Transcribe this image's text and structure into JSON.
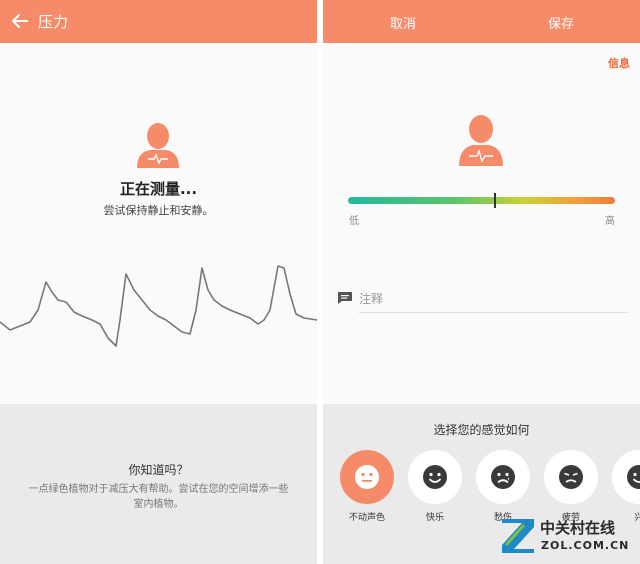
{
  "left_screen": {
    "appbar": {
      "title": "压力",
      "back_icon": "arrow-left-icon",
      "color": "#f58b69"
    },
    "avatar_icon": "person-heartbeat-icon",
    "measuring_title": "正在测量...",
    "measuring_subtitle": "尝试保持静止和安静。",
    "tip": {
      "title": "你知道吗？",
      "body": "一点绿色植物对于减压大有帮助。尝试在您的空间增添一些室内植物。"
    }
  },
  "right_screen": {
    "appbar": {
      "cancel_label": "取消",
      "save_label": "保存"
    },
    "info_label": "信息",
    "avatar_icon": "person-heartbeat-icon",
    "scale": {
      "low_label": "低",
      "high_label": "高",
      "level": 0.55
    },
    "note": {
      "icon": "comment-icon",
      "placeholder": "注释"
    },
    "mood_title": "选择您的感觉如何",
    "moods": [
      {
        "label": "不动声色",
        "icon": "neutral-face-icon",
        "selected": true
      },
      {
        "label": "快乐",
        "icon": "happy-face-icon",
        "selected": false
      },
      {
        "label": "愁伤",
        "icon": "sad-face-icon",
        "selected": false
      },
      {
        "label": "疲劳",
        "icon": "tired-face-icon",
        "selected": false
      },
      {
        "label": "兴",
        "icon": "partial-face-icon",
        "selected": false
      }
    ]
  },
  "watermark": {
    "cn": "中关村在线",
    "en": "ZOL.COM.CN"
  },
  "colors": {
    "accent": "#f58b69",
    "tip_background": "#eaeaea",
    "info_link": "#f06a3c"
  }
}
